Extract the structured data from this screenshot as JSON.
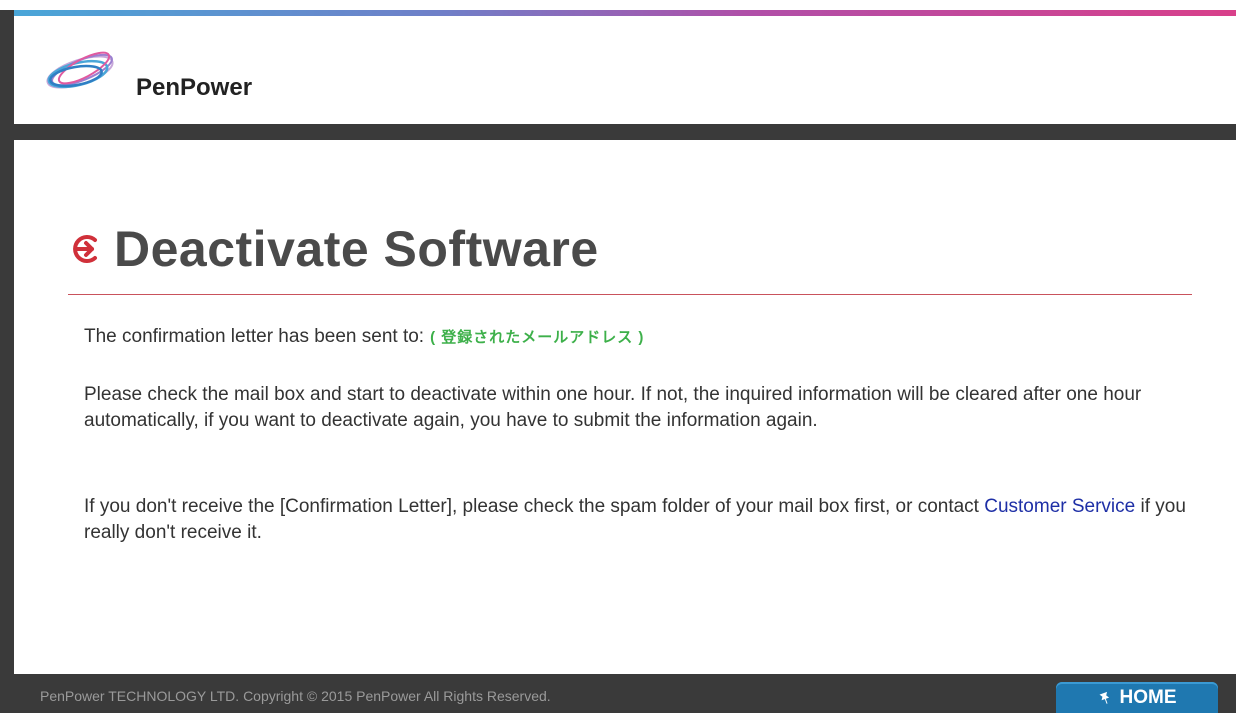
{
  "brand": {
    "name": "PenPower"
  },
  "page": {
    "title": "Deactivate Software"
  },
  "message": {
    "sent_prefix": "The confirmation letter has been sent to:",
    "email_placeholder": "( 登録されたメールアドレス )",
    "para2": "Please check the mail box and start to deactivate within one hour. If not, the inquired information will be cleared after one hour automatically, if you want to deactivate again, you have to submit the information again.",
    "para3_before": "If you don't receive the [Confirmation Letter], please check the spam folder of your mail box first, or contact ",
    "para3_link": "Customer Service",
    "para3_after": " if you really don't receive it."
  },
  "footer": {
    "copyright": "PenPower TECHNOLOGY LTD. Copyright © 2015 PenPower All Rights Reserved.",
    "home_label": "HOME"
  },
  "colors": {
    "accent_red": "#d0303a",
    "email_green": "#3db04a",
    "link_blue": "#1e2fa6",
    "home_blue": "#1f78b0"
  },
  "icons": {
    "logo": "penpower-logo-icon",
    "title": "circle-arrow-right-icon",
    "home": "pin-icon"
  }
}
